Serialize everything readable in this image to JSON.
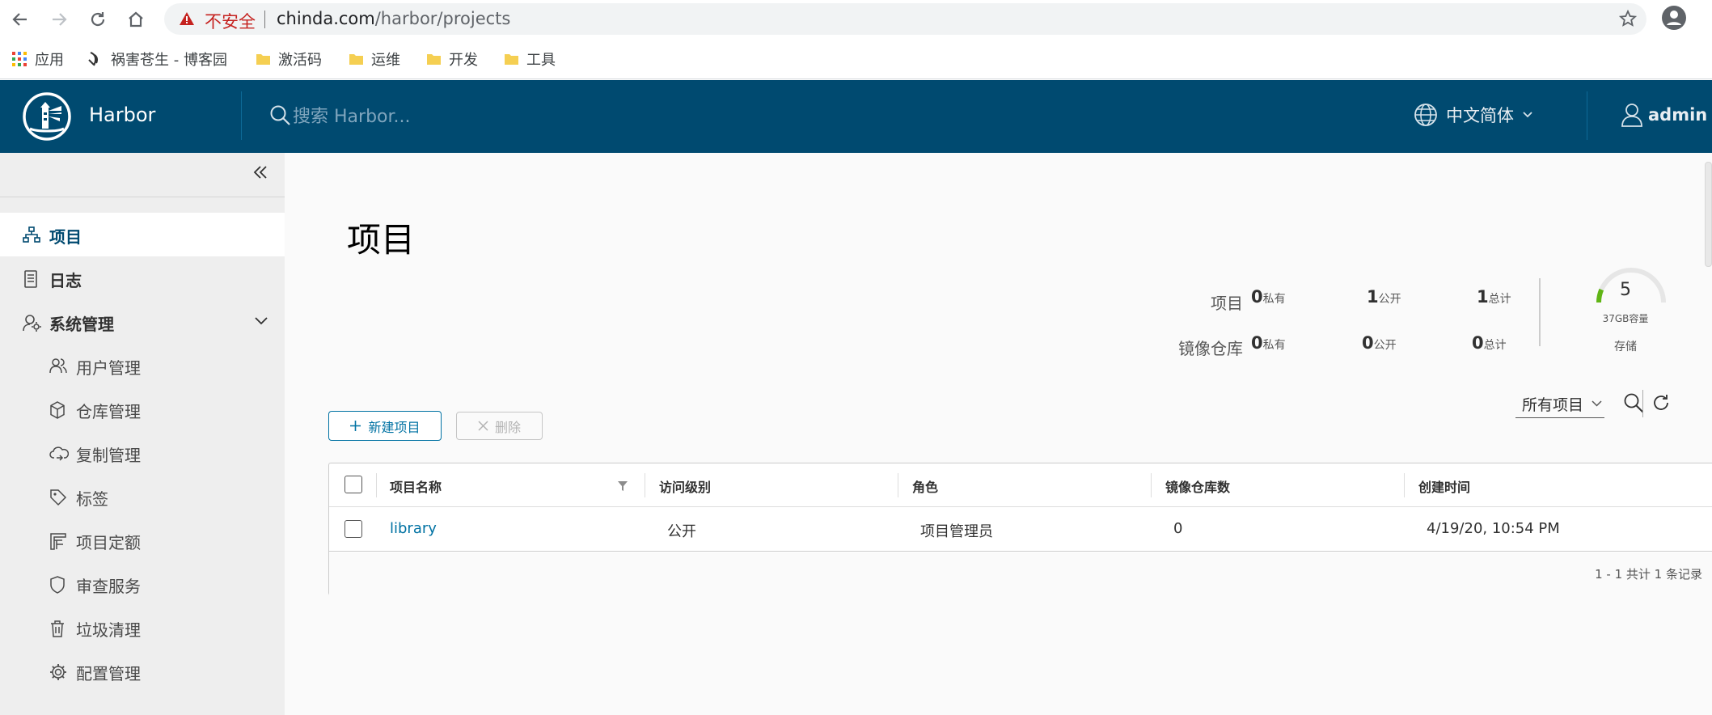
{
  "browser": {
    "security_label": "不安全",
    "url_host": "chinda.com",
    "url_path": "/harbor/projects"
  },
  "bookmarks": [
    {
      "label": "应用"
    },
    {
      "label": "祸害苍生 - 博客园"
    },
    {
      "label": "激活码"
    },
    {
      "label": "运维"
    },
    {
      "label": "开发"
    },
    {
      "label": "工具"
    }
  ],
  "header": {
    "brand": "Harbor",
    "search_placeholder": "搜索 Harbor...",
    "language": "中文简体",
    "user": "admin"
  },
  "sidebar": {
    "items": [
      {
        "label": "项目",
        "icon": "projects-icon",
        "active": true
      },
      {
        "label": "日志",
        "icon": "logs-icon"
      },
      {
        "label": "系统管理",
        "icon": "admin-icon"
      }
    ],
    "sub_items": [
      {
        "label": "用户管理",
        "icon": "users-icon"
      },
      {
        "label": "仓库管理",
        "icon": "registry-icon"
      },
      {
        "label": "复制管理",
        "icon": "replication-icon"
      },
      {
        "label": "标签",
        "icon": "tag-icon"
      },
      {
        "label": "项目定额",
        "icon": "quota-icon"
      },
      {
        "label": "审查服务",
        "icon": "shield-icon"
      },
      {
        "label": "垃圾清理",
        "icon": "trash-icon"
      },
      {
        "label": "配置管理",
        "icon": "gear-icon"
      }
    ]
  },
  "page": {
    "title": "项目"
  },
  "stats": {
    "projects_label": "项目",
    "repos_label": "镜像仓库",
    "projects": {
      "private": "0",
      "public": "1",
      "total": "1"
    },
    "repos": {
      "private": "0",
      "public": "0",
      "total": "0"
    },
    "private_suffix": "私有",
    "public_suffix": "公开",
    "total_suffix": "总计",
    "storage_value": "5",
    "storage_capacity": "37GB容量",
    "storage_label": "存储",
    "storage_used_fraction": 0.13
  },
  "toolbar": {
    "new_label": "新建项目",
    "delete_label": "删除",
    "filter_value": "所有项目"
  },
  "table": {
    "columns": [
      "项目名称",
      "访问级别",
      "角色",
      "镜像仓库数",
      "创建时间"
    ],
    "rows": [
      {
        "name": "library",
        "access": "公开",
        "role": "项目管理员",
        "repo_count": "0",
        "created": "4/19/20, 10:54 PM"
      }
    ],
    "footer": "1 - 1 共计 1 条记录"
  },
  "colors": {
    "header_bg": "#004a70",
    "accent": "#0072a3",
    "gauge_fill": "#60b515"
  }
}
